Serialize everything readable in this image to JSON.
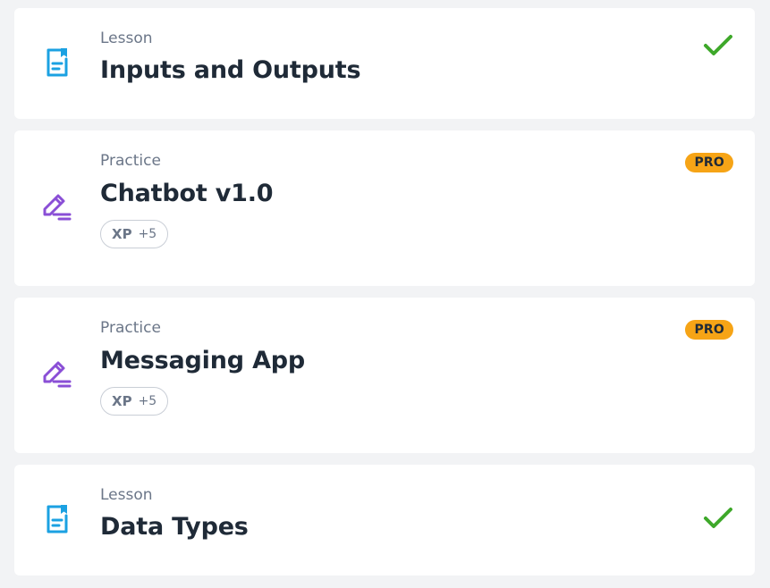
{
  "colors": {
    "lesson_icon": "#1ba1e2",
    "practice_icon": "#8a4fd6",
    "check": "#3ea82a",
    "pro_badge": "#f6a416"
  },
  "items": [
    {
      "kind": "lesson",
      "type_label": "Lesson",
      "title": "Inputs and Outputs",
      "icon": "lesson-document-icon",
      "status": "completed"
    },
    {
      "kind": "practice",
      "type_label": "Practice",
      "title": "Chatbot v1.0",
      "icon": "practice-pencil-icon",
      "badge": "PRO",
      "xp_label": "XP",
      "xp_value": "+5"
    },
    {
      "kind": "practice",
      "type_label": "Practice",
      "title": "Messaging App",
      "icon": "practice-pencil-icon",
      "badge": "PRO",
      "xp_label": "XP",
      "xp_value": "+5"
    },
    {
      "kind": "lesson",
      "type_label": "Lesson",
      "title": "Data Types",
      "icon": "lesson-document-icon",
      "status": "completed"
    }
  ]
}
